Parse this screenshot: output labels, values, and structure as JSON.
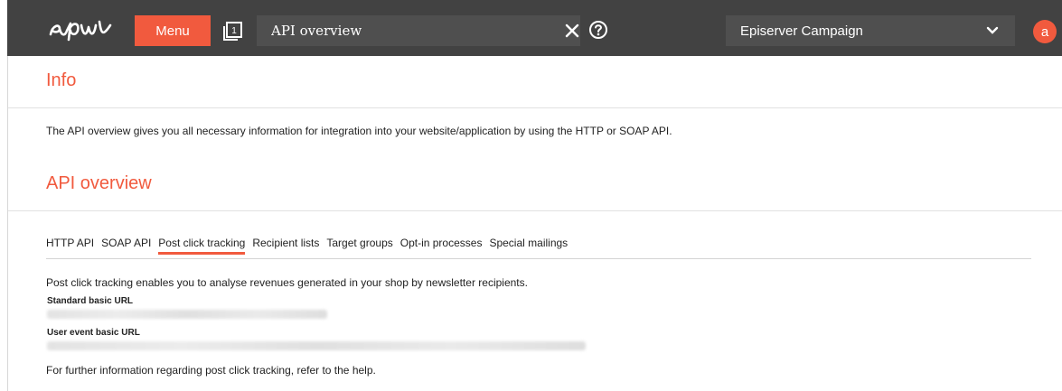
{
  "topbar": {
    "logo_icon": "episerver-logo",
    "menu_label": "Menu",
    "tabs_icon": "window-list-icon",
    "search_value": "API overview",
    "clear_icon": "close-icon",
    "help_icon": "help-icon",
    "client_selected": "Episerver Campaign",
    "avatar_letter": "a",
    "colors": {
      "bar": "#424242",
      "accent": "#f15a3e"
    }
  },
  "info": {
    "title": "Info",
    "text": "The API overview gives you all necessary information for integration into your website/application by using the HTTP or SOAP API."
  },
  "api": {
    "title": "API overview",
    "tabs": [
      {
        "label": "HTTP API",
        "active": false
      },
      {
        "label": "SOAP API",
        "active": false
      },
      {
        "label": "Post click tracking",
        "active": true
      },
      {
        "label": "Recipient lists",
        "active": false
      },
      {
        "label": "Target groups",
        "active": false
      },
      {
        "label": "Opt-in processes",
        "active": false
      },
      {
        "label": "Special mailings",
        "active": false
      }
    ],
    "post_click": {
      "description": "Post click tracking enables you to analyse revenues generated in your shop by newsletter recipients.",
      "standard_label": "Standard basic URL",
      "user_event_label": "User event basic URL",
      "further": "For further information regarding post click tracking, refer to the help."
    }
  }
}
